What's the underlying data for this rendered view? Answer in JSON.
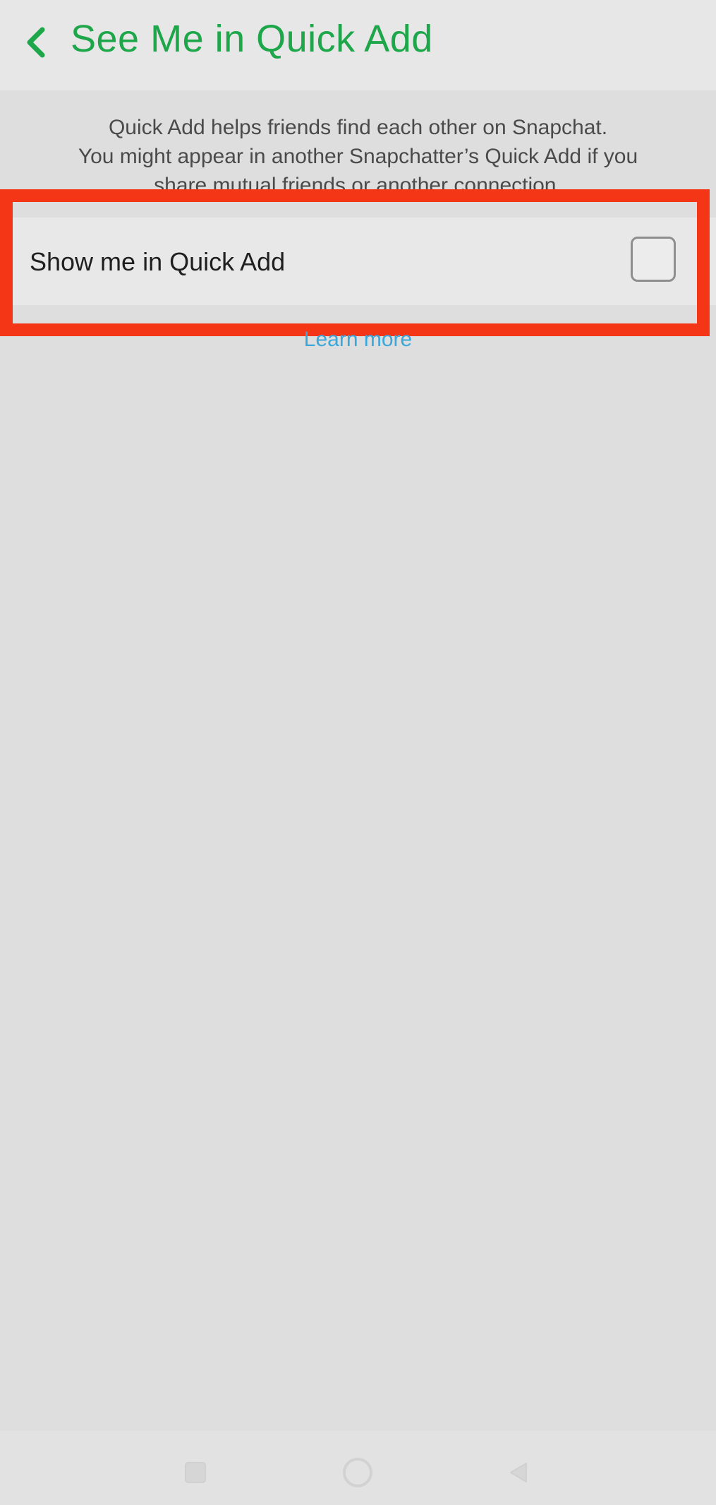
{
  "header": {
    "back_icon": "chevron-left-icon",
    "title": "See Me in Quick Add"
  },
  "description": {
    "line1": "Quick Add helps friends find each other on Snapchat.",
    "line2": "You might appear in another Snapchatter’s Quick Add if you",
    "line3": "share mutual friends or another connection."
  },
  "setting": {
    "label": "Show me in Quick Add",
    "checked": false
  },
  "learn_more": "Learn more",
  "nav": {
    "recent_icon": "square-icon",
    "home_icon": "circle-icon",
    "back_icon": "triangle-back-icon"
  },
  "colors": {
    "accent_green": "#1ea64a",
    "link_blue": "#3aa7db",
    "highlight_red": "#f43516",
    "background": "#dedede"
  }
}
